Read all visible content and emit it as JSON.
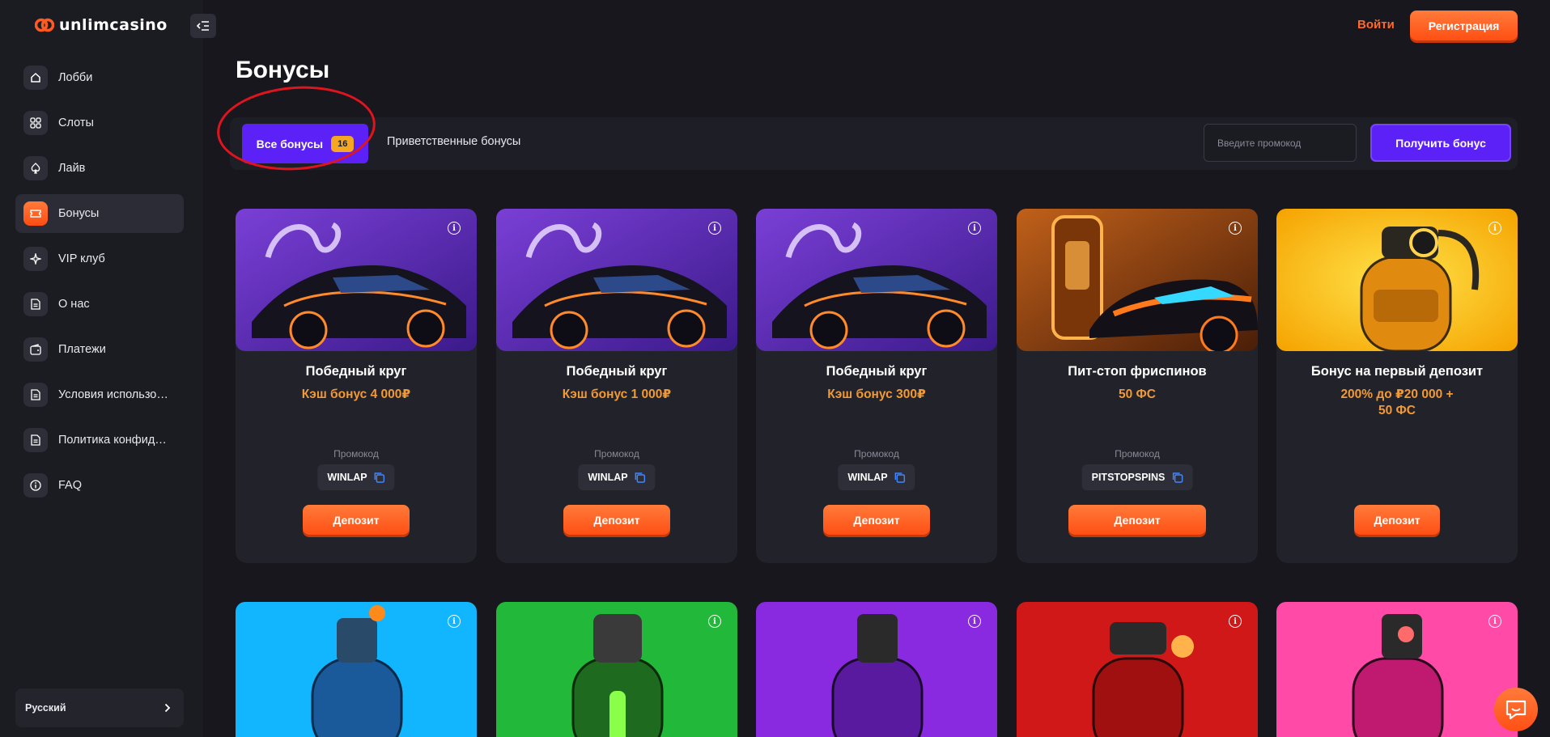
{
  "brand": {
    "name": "unlimcasino",
    "accent": "#ff5a1f",
    "purple": "#5b21f6"
  },
  "sidebar": {
    "items": [
      {
        "label": "Лобби",
        "icon": "home-icon",
        "active": false
      },
      {
        "label": "Слоты",
        "icon": "grid-icon",
        "active": false
      },
      {
        "label": "Лайв",
        "icon": "spade-icon",
        "active": false
      },
      {
        "label": "Бонусы",
        "icon": "ticket-icon",
        "active": true
      },
      {
        "label": "VIP клуб",
        "icon": "sparkle-icon",
        "active": false
      },
      {
        "label": "О нас",
        "icon": "document-icon",
        "active": false
      },
      {
        "label": "Платежи",
        "icon": "wallet-icon",
        "active": false
      },
      {
        "label": "Условия использова...",
        "icon": "document-icon",
        "active": false
      },
      {
        "label": "Политика конфиден...",
        "icon": "document-icon",
        "active": false
      },
      {
        "label": "FAQ",
        "icon": "info-icon",
        "active": false
      }
    ],
    "language": "Русский"
  },
  "header": {
    "login": "Войти",
    "register": "Регистрация"
  },
  "page": {
    "title": "Бонусы"
  },
  "filters": {
    "all_label": "Все бонусы",
    "all_count": "16",
    "welcome_label": "Приветственные бонусы",
    "promo_placeholder": "Введите промокод",
    "get_bonus": "Получить бонус"
  },
  "cards": [
    {
      "title": "Победный круг",
      "subtitle": "Кэш бонус 4 000₽",
      "promo_label": "Промокод",
      "promo_code": "WINLAP",
      "cta": "Депозит"
    },
    {
      "title": "Победный круг",
      "subtitle": "Кэш бонус 1 000₽",
      "promo_label": "Промокод",
      "promo_code": "WINLAP",
      "cta": "Депозит"
    },
    {
      "title": "Победный круг",
      "subtitle": "Кэш бонус 300₽",
      "promo_label": "Промокод",
      "promo_code": "WINLAP",
      "cta": "Депозит"
    },
    {
      "title": "Пит-стоп фриспинов",
      "subtitle": "50 ФС",
      "promo_label": "Промокод",
      "promo_code": "PITSTOPSPINS",
      "cta": "Депозит"
    },
    {
      "title": "Бонус на первый депозит",
      "subtitle_line1": "200% до ₽20 000 +",
      "subtitle_line2": "50 ФС",
      "cta": "Депозит"
    }
  ]
}
